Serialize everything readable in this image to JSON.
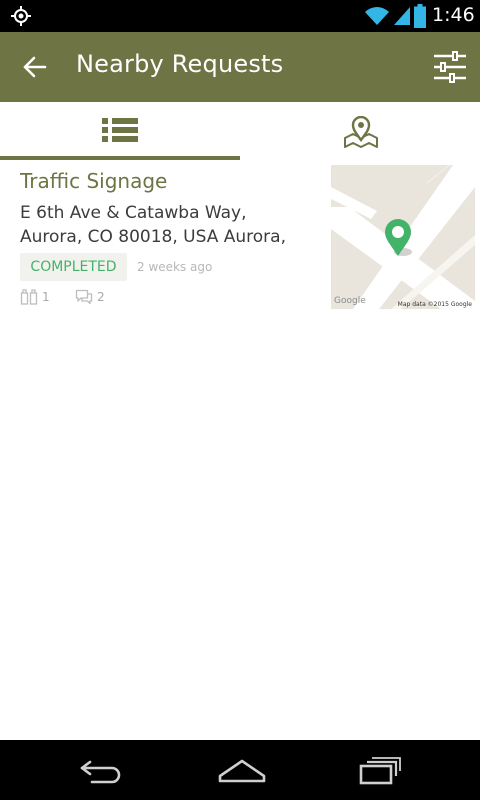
{
  "status_bar": {
    "time": "1:46",
    "icons": [
      "location-icon",
      "wifi-icon",
      "signal-icon",
      "battery-icon"
    ]
  },
  "app_bar": {
    "title": "Nearby Requests",
    "background": "#6e7443",
    "icons": [
      "back-arrow-icon",
      "filter-sliders-icon"
    ]
  },
  "tabs": [
    {
      "name": "list",
      "icon": "list-icon",
      "selected": true
    },
    {
      "name": "map",
      "icon": "map-pin-icon",
      "selected": false
    }
  ],
  "requests": [
    {
      "title": "Traffic Signage",
      "address_line1": "E 6th Ave & Catawba Way,",
      "address_line2": "Aurora, CO 80018, USA Aurora,",
      "status": "COMPLETED",
      "status_color": "#43b36a",
      "time_ago": "2 weeks ago",
      "votes": "1",
      "comments": "2",
      "map": {
        "provider_mark": "Google",
        "attribution": "Map data ©2015 Google",
        "marker_color": "#43b36a"
      }
    }
  ],
  "nav_bar": {
    "icons": [
      "back-nav-icon",
      "home-nav-icon",
      "recents-nav-icon"
    ]
  }
}
